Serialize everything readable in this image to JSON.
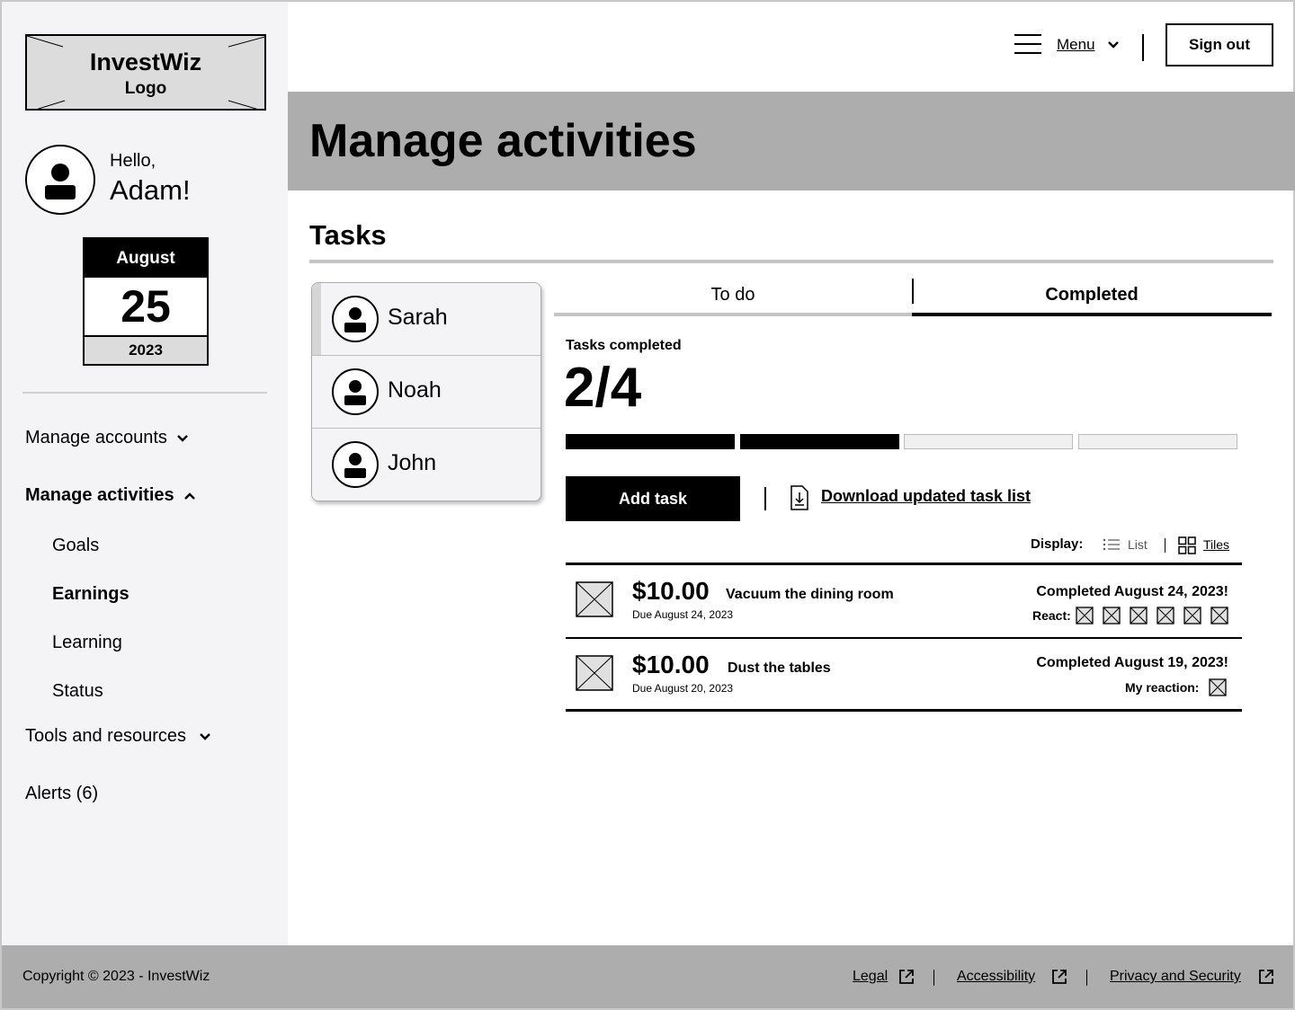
{
  "brand": {
    "logo_title": "InvestWiz",
    "logo_subtitle": "Logo"
  },
  "user": {
    "greeting": "Hello,",
    "name": "Adam!"
  },
  "calendar": {
    "month": "August",
    "day": "25",
    "year": "2023"
  },
  "sidebar": {
    "items": [
      {
        "label": "Manage accounts",
        "icon": "chevron-down-icon"
      },
      {
        "label": "Manage activities",
        "icon": "chevron-up-icon",
        "expanded": true
      },
      {
        "label": "Tools and resources",
        "icon": "chevron-down-icon"
      },
      {
        "label": "Alerts (6)"
      }
    ],
    "sub_items": [
      {
        "label": "Goals"
      },
      {
        "label": "Earnings",
        "active": true
      },
      {
        "label": "Learning"
      },
      {
        "label": "Status"
      }
    ]
  },
  "header": {
    "menu_label": "Menu",
    "sign_out_label": "Sign out"
  },
  "page": {
    "title": "Manage activities",
    "section_title": "Tasks"
  },
  "people": [
    {
      "name": "Sarah",
      "active": true
    },
    {
      "name": "Noah"
    },
    {
      "name": "John"
    }
  ],
  "tabs": [
    {
      "label": "To do"
    },
    {
      "label": "Completed",
      "active": true
    }
  ],
  "progress": {
    "label": "Tasks completed",
    "value": "2/4",
    "completed": 2,
    "total": 4
  },
  "actions": {
    "add_task_label": "Add task",
    "download_label": "Download updated task list"
  },
  "display": {
    "label": "Display:",
    "list_label": "List",
    "tiles_label": "Tiles",
    "selected": "Tiles"
  },
  "tasks": [
    {
      "amount": "$10.00",
      "name": "Vacuum the dining room",
      "due": "Due August 24, 2023",
      "completed": "Completed August 24, 2023!",
      "react_label": "React:",
      "reaction_count": 6
    },
    {
      "amount": "$10.00",
      "name": "Dust the tables",
      "due": "Due August 20, 2023",
      "completed": "Completed August 19, 2023!",
      "react_label": "My reaction:",
      "reaction_count": 1
    }
  ],
  "footer": {
    "copyright": "Copyright © 2023 - InvestWiz",
    "links": [
      {
        "label": "Legal"
      },
      {
        "label": "Accessibility"
      },
      {
        "label": "Privacy and Security"
      }
    ]
  },
  "colors": {
    "banner_bg": "#adadad",
    "sidebar_bg": "#f4f4f6",
    "footer_bg": "#adadad",
    "accent": "#000000"
  }
}
